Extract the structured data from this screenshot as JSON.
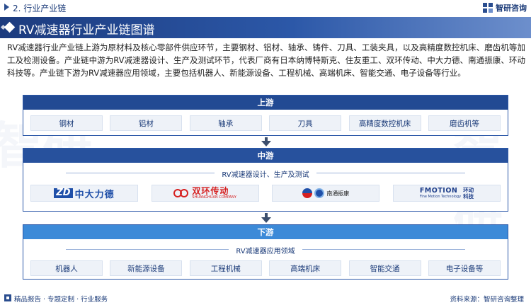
{
  "header": {
    "section_label": "2. 行业产业链",
    "brand_name": "智研咨询"
  },
  "title": "RV减速器行业产业链图谱",
  "intro": "RV减速器行业产业链上游为原材料及核心零部件供应环节，主要钢材、铝材、轴承、铸件、刀具、工装夹具，以及高精度数控机床、磨齿机等加工及检测设备。产业链中游为RV减速器设计、生产及测试环节，代表厂商有日本纳博特斯克、住友重工、双环传动、中大力德、南通振康、环动科技等。产业链下游为RV减速器应用领域，主要包括机器人、新能源设备、工程机械、高端机床、智能交通、电子设备等行业。",
  "upstream": {
    "title": "上游",
    "items": [
      "钢材",
      "铝材",
      "轴承",
      "刀具",
      "高精度数控机床",
      "磨齿机等"
    ]
  },
  "midstream": {
    "title": "中游",
    "subtitle": "RV减速器设计、生产及测试",
    "companies": {
      "zd": {
        "mark": "ZD",
        "name": "中大力德"
      },
      "sh": {
        "name": "双环传动",
        "en": "SHUANGHUAN COMPANY"
      },
      "nt": {
        "name": "南通振康"
      },
      "fm": {
        "word": "FMOTION",
        "sub": "Fine Motion Technology",
        "cn1": "环动",
        "cn2": "科技"
      }
    }
  },
  "downstream": {
    "title": "下游",
    "subtitle": "RV减速器应用领域",
    "items": [
      "机器人",
      "新能源设备",
      "工程机械",
      "高端机床",
      "智能交通",
      "电子设备等"
    ]
  },
  "footer": {
    "left": "精品报告 · 专题定制 · 行业服务",
    "right": "资料来源：智研咨询整理"
  },
  "watermark": "智研"
}
